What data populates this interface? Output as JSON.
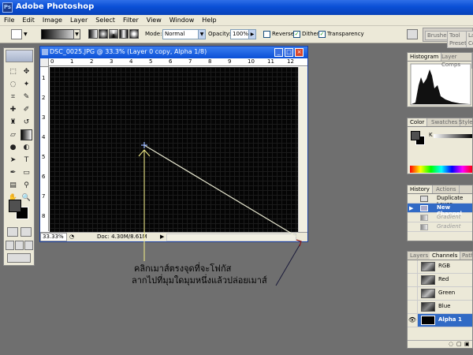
{
  "app": {
    "title": "Adobe Photoshop"
  },
  "menu": [
    "File",
    "Edit",
    "Image",
    "Layer",
    "Select",
    "Filter",
    "View",
    "Window",
    "Help"
  ],
  "options": {
    "mode_label": "Mode:",
    "mode_value": "Normal",
    "opacity_label": "Opacity:",
    "opacity_value": "100%",
    "reverse_label": "Reverse",
    "dither_label": "Dither",
    "transparency_label": "Transparency",
    "reverse_checked": false,
    "dither_checked": true,
    "transparency_checked": true
  },
  "well_tabs": [
    "Brushes",
    "Tool Presets",
    "Layer Comps"
  ],
  "document": {
    "title": "DSC_0025.JPG @ 33.3% (Layer 0 copy, Alpha 1/8)",
    "zoom": "33.33%",
    "doc_size": "Doc: 4.30M/8.61M",
    "ruler_top": [
      "0",
      "1",
      "2",
      "3",
      "4",
      "5",
      "6",
      "7",
      "8",
      "9",
      "10",
      "11",
      "12"
    ],
    "ruler_left": [
      "1",
      "2",
      "3",
      "4",
      "5",
      "6",
      "7",
      "8"
    ]
  },
  "histogram": {
    "tabs": [
      "Histogram",
      "Layer Comps"
    ]
  },
  "color": {
    "tabs": [
      "Color",
      "Swatches",
      "Styles"
    ],
    "k_label": "K"
  },
  "history": {
    "tabs": [
      "History",
      "Actions"
    ],
    "items": [
      {
        "label": "Duplicate Layer",
        "selected": false
      },
      {
        "label": "New Channel",
        "selected": true
      },
      {
        "label": "Gradient",
        "selected": false,
        "dimmed": true
      },
      {
        "label": "Gradient",
        "selected": false,
        "dimmed": true
      }
    ]
  },
  "channels": {
    "tabs": [
      "Layers",
      "Channels",
      "Paths"
    ],
    "items": [
      {
        "label": "RGB",
        "selected": false
      },
      {
        "label": "Red",
        "selected": false
      },
      {
        "label": "Green",
        "selected": false
      },
      {
        "label": "Blue",
        "selected": false
      },
      {
        "label": "Alpha 1",
        "selected": true
      }
    ]
  },
  "annotation": {
    "line1": "คลิกเมาส์ตรงจุดที่จะโฟกัส",
    "line2": "ลากไปที่มุมใดมุมหนึ่งแล้วปล่อยเมาส์"
  },
  "colors": {
    "titlebar": "#0a4fd6",
    "selection": "#316ac5",
    "workspace": "#6f6f6f",
    "guide": "#f5f08a"
  }
}
